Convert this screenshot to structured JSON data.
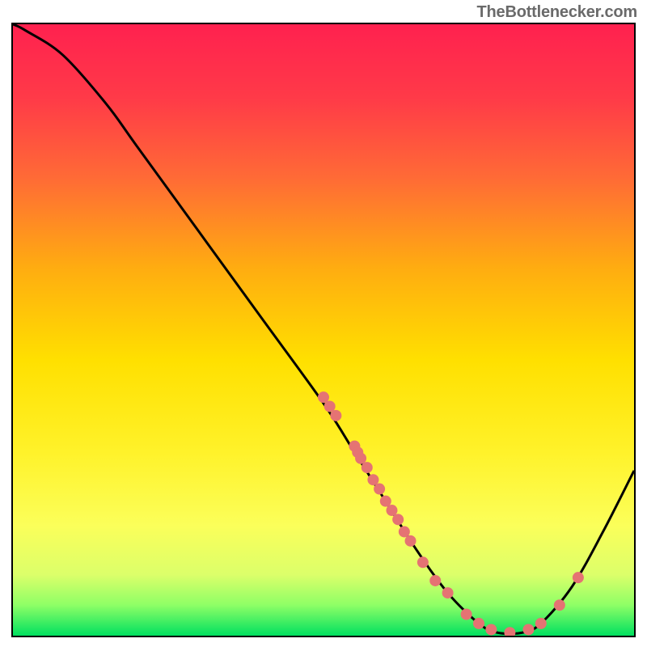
{
  "attribution": "TheBottlenecker.com",
  "chart_data": {
    "type": "line",
    "title": "",
    "xlabel": "",
    "ylabel": "",
    "y_high_color": "#ff2050",
    "y_low_color": "#00e060",
    "xlim": [
      0,
      100
    ],
    "ylim": [
      0,
      100
    ],
    "curve": [
      {
        "x": 0,
        "y": 100
      },
      {
        "x": 2,
        "y": 99
      },
      {
        "x": 8,
        "y": 95
      },
      {
        "x": 15,
        "y": 87
      },
      {
        "x": 20,
        "y": 80
      },
      {
        "x": 30,
        "y": 66
      },
      {
        "x": 40,
        "y": 52
      },
      {
        "x": 50,
        "y": 38
      },
      {
        "x": 55,
        "y": 30
      },
      {
        "x": 60,
        "y": 22
      },
      {
        "x": 65,
        "y": 14
      },
      {
        "x": 70,
        "y": 7
      },
      {
        "x": 75,
        "y": 2
      },
      {
        "x": 78,
        "y": 0.5
      },
      {
        "x": 82,
        "y": 0.5
      },
      {
        "x": 85,
        "y": 2
      },
      {
        "x": 90,
        "y": 8
      },
      {
        "x": 95,
        "y": 17
      },
      {
        "x": 100,
        "y": 27
      }
    ],
    "markers": [
      {
        "x": 50,
        "y": 39
      },
      {
        "x": 51,
        "y": 37.5
      },
      {
        "x": 52,
        "y": 36
      },
      {
        "x": 55,
        "y": 31
      },
      {
        "x": 55.5,
        "y": 30
      },
      {
        "x": 56,
        "y": 29
      },
      {
        "x": 57,
        "y": 27.5
      },
      {
        "x": 58,
        "y": 25.5
      },
      {
        "x": 59,
        "y": 24
      },
      {
        "x": 60,
        "y": 22
      },
      {
        "x": 61,
        "y": 20.5
      },
      {
        "x": 62,
        "y": 19
      },
      {
        "x": 63,
        "y": 17
      },
      {
        "x": 64,
        "y": 15.5
      },
      {
        "x": 66,
        "y": 12
      },
      {
        "x": 68,
        "y": 9
      },
      {
        "x": 70,
        "y": 7
      },
      {
        "x": 73,
        "y": 3.5
      },
      {
        "x": 75,
        "y": 2
      },
      {
        "x": 77,
        "y": 1
      },
      {
        "x": 80,
        "y": 0.5
      },
      {
        "x": 83,
        "y": 1
      },
      {
        "x": 85,
        "y": 2
      },
      {
        "x": 88,
        "y": 5
      },
      {
        "x": 91,
        "y": 9.5
      }
    ],
    "marker_color": "#e57373",
    "marker_radius": 7
  }
}
